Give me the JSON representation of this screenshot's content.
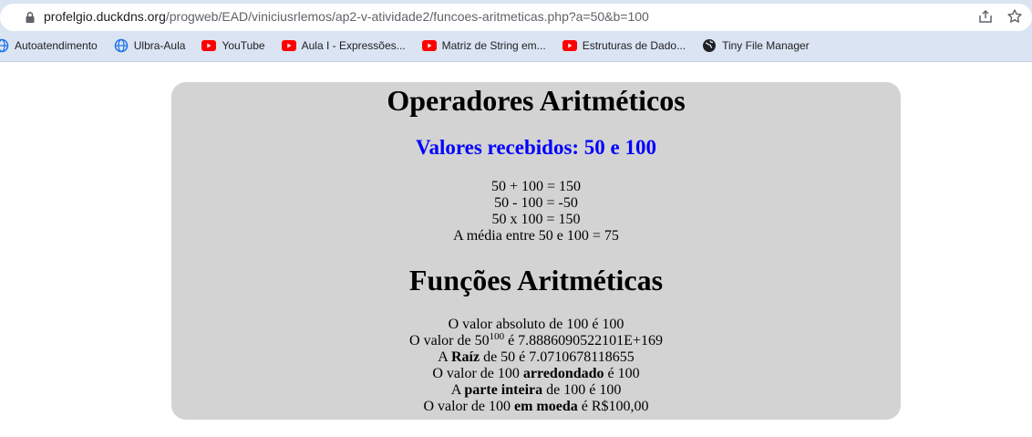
{
  "browser": {
    "url_host": "profelgio.duckdns.org",
    "url_path": "/progweb/EAD/viniciusrlemos/ap2-v-atividade2/funcoes-aritmeticas.php?a=50&b=100",
    "bookmarks": [
      {
        "label": "Autoatendimento",
        "icon": "globe-icon"
      },
      {
        "label": "Ulbra-Aula",
        "icon": "globe-icon"
      },
      {
        "label": "YouTube",
        "icon": "youtube-icon"
      },
      {
        "label": "Aula I - Expressões...",
        "icon": "youtube-icon"
      },
      {
        "label": "Matriz de String em...",
        "icon": "youtube-icon"
      },
      {
        "label": "Estruturas de Dado...",
        "icon": "youtube-icon"
      },
      {
        "label": "Tiny File Manager",
        "icon": "globe-dark-icon"
      }
    ]
  },
  "page": {
    "title": "Operadores Aritméticos",
    "received": "Valores recebidos: 50 e 100",
    "ops": [
      "50 + 100 = 150",
      "50 - 100 = -50",
      "50 x 100 = 150",
      "A média entre 50 e 100 = 75"
    ],
    "functions_title": "Funções Aritméticas",
    "functions": {
      "abs": "O valor absoluto de 100 é 100",
      "pow_prefix": "O valor de 50",
      "pow_exp": "100",
      "pow_suffix": " é 7.8886090522101E+169",
      "sqrt_a": "A ",
      "sqrt_bold": "Raíz",
      "sqrt_b": " de 50 é 7.0710678118655",
      "round_a": "O valor de 100 ",
      "round_bold": "arredondado",
      "round_b": " é 100",
      "int_a": "A ",
      "int_bold": "parte inteira",
      "int_b": " de 100 é 100",
      "money_a": "O valor de 100 ",
      "money_bold": "em moeda",
      "money_b": " é R$100,00"
    }
  },
  "colors": {
    "card_bg": "#d3d3d3",
    "highlight": "#0000ff",
    "chrome_bg": "#dbe4f2"
  }
}
